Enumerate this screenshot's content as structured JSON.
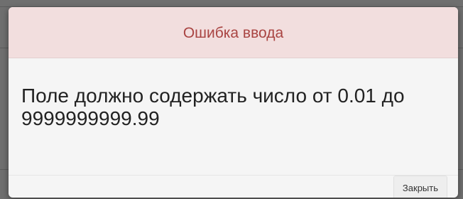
{
  "dialog": {
    "title": "Ошибка ввода",
    "message": "Поле должно содержать число от 0.01 до 9999999999.99",
    "close_label": "Закрыть"
  },
  "colors": {
    "header_background": "#f2dede",
    "title_text": "#a94442",
    "overlay": "#6f6f6f",
    "body_background": "#f5f5f5"
  }
}
